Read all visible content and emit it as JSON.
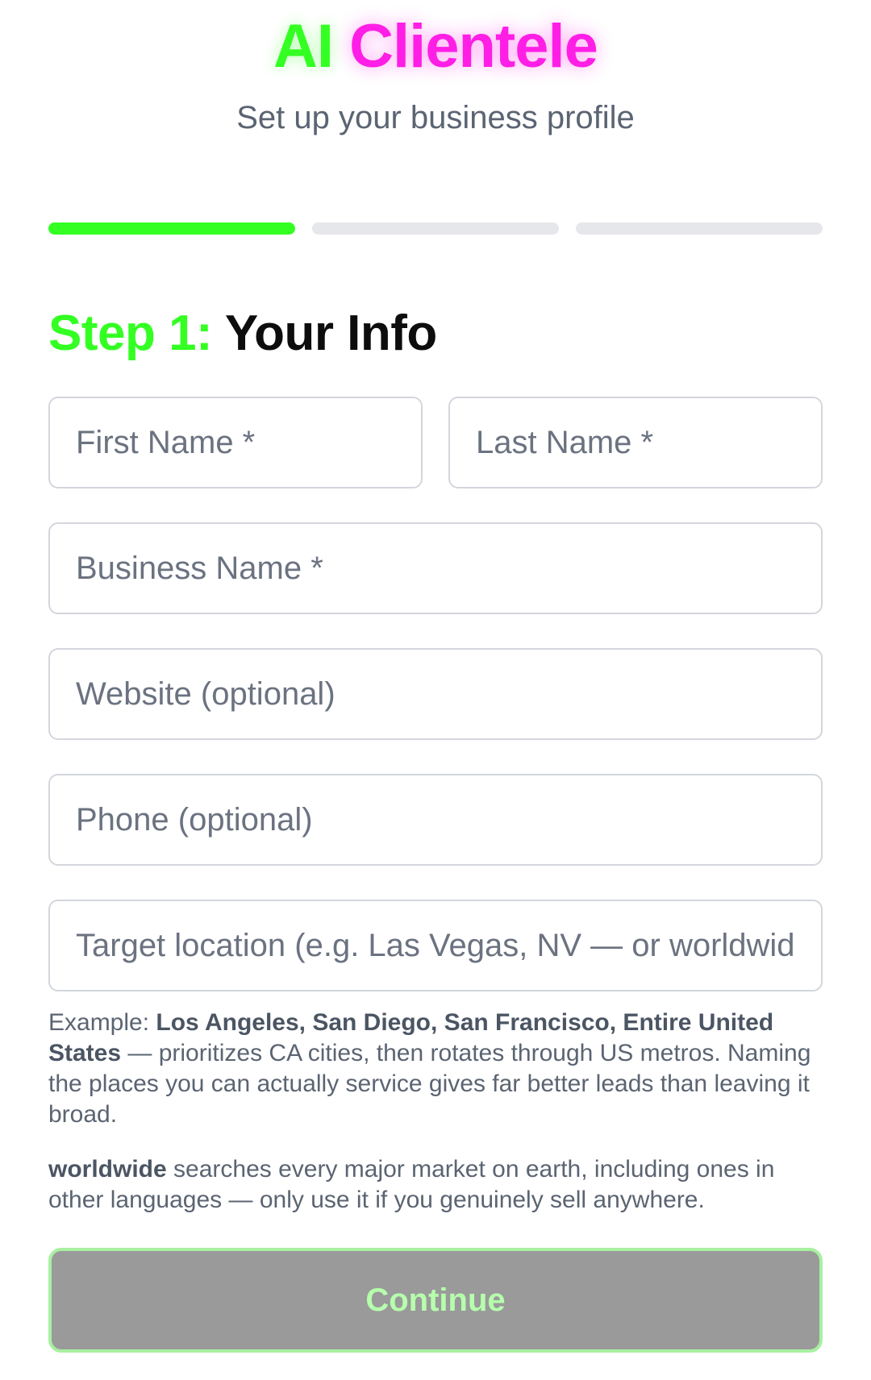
{
  "brand": {
    "part1": "AI",
    "part2": "Clientele",
    "colors": {
      "part1": "#33ff22",
      "part2": "#ff1ee6"
    }
  },
  "subtitle": "Set up your business profile",
  "progress": {
    "total_steps": 3,
    "current_step": 1
  },
  "step": {
    "label": "Step 1:",
    "title": "Your Info"
  },
  "fields": {
    "first_name": {
      "placeholder": "First Name *",
      "value": ""
    },
    "last_name": {
      "placeholder": "Last Name *",
      "value": ""
    },
    "business_name": {
      "placeholder": "Business Name *",
      "value": ""
    },
    "website": {
      "placeholder": "Website (optional)",
      "value": ""
    },
    "phone": {
      "placeholder": "Phone (optional)",
      "value": ""
    },
    "target_location": {
      "placeholder": "Target location (e.g. Las Vegas, NV — or worldwide)",
      "value": ""
    }
  },
  "help": {
    "example_prefix": "Example: ",
    "example_bold": "Los Angeles, San Diego, San Francisco, Entire United States",
    "example_rest": " — prioritizes CA cities, then rotates through US metros. Naming the places you can actually service gives far better leads than leaving it broad.",
    "worldwide_bold": "worldwide",
    "worldwide_rest": " searches every major market on earth, including ones in other languages — only use it if you genuinely sell anywhere."
  },
  "button": {
    "continue_label": "Continue"
  },
  "colors": {
    "accent_green": "#33ff22",
    "button_bg": "#9a9a9a",
    "button_text": "#b6ffac"
  }
}
